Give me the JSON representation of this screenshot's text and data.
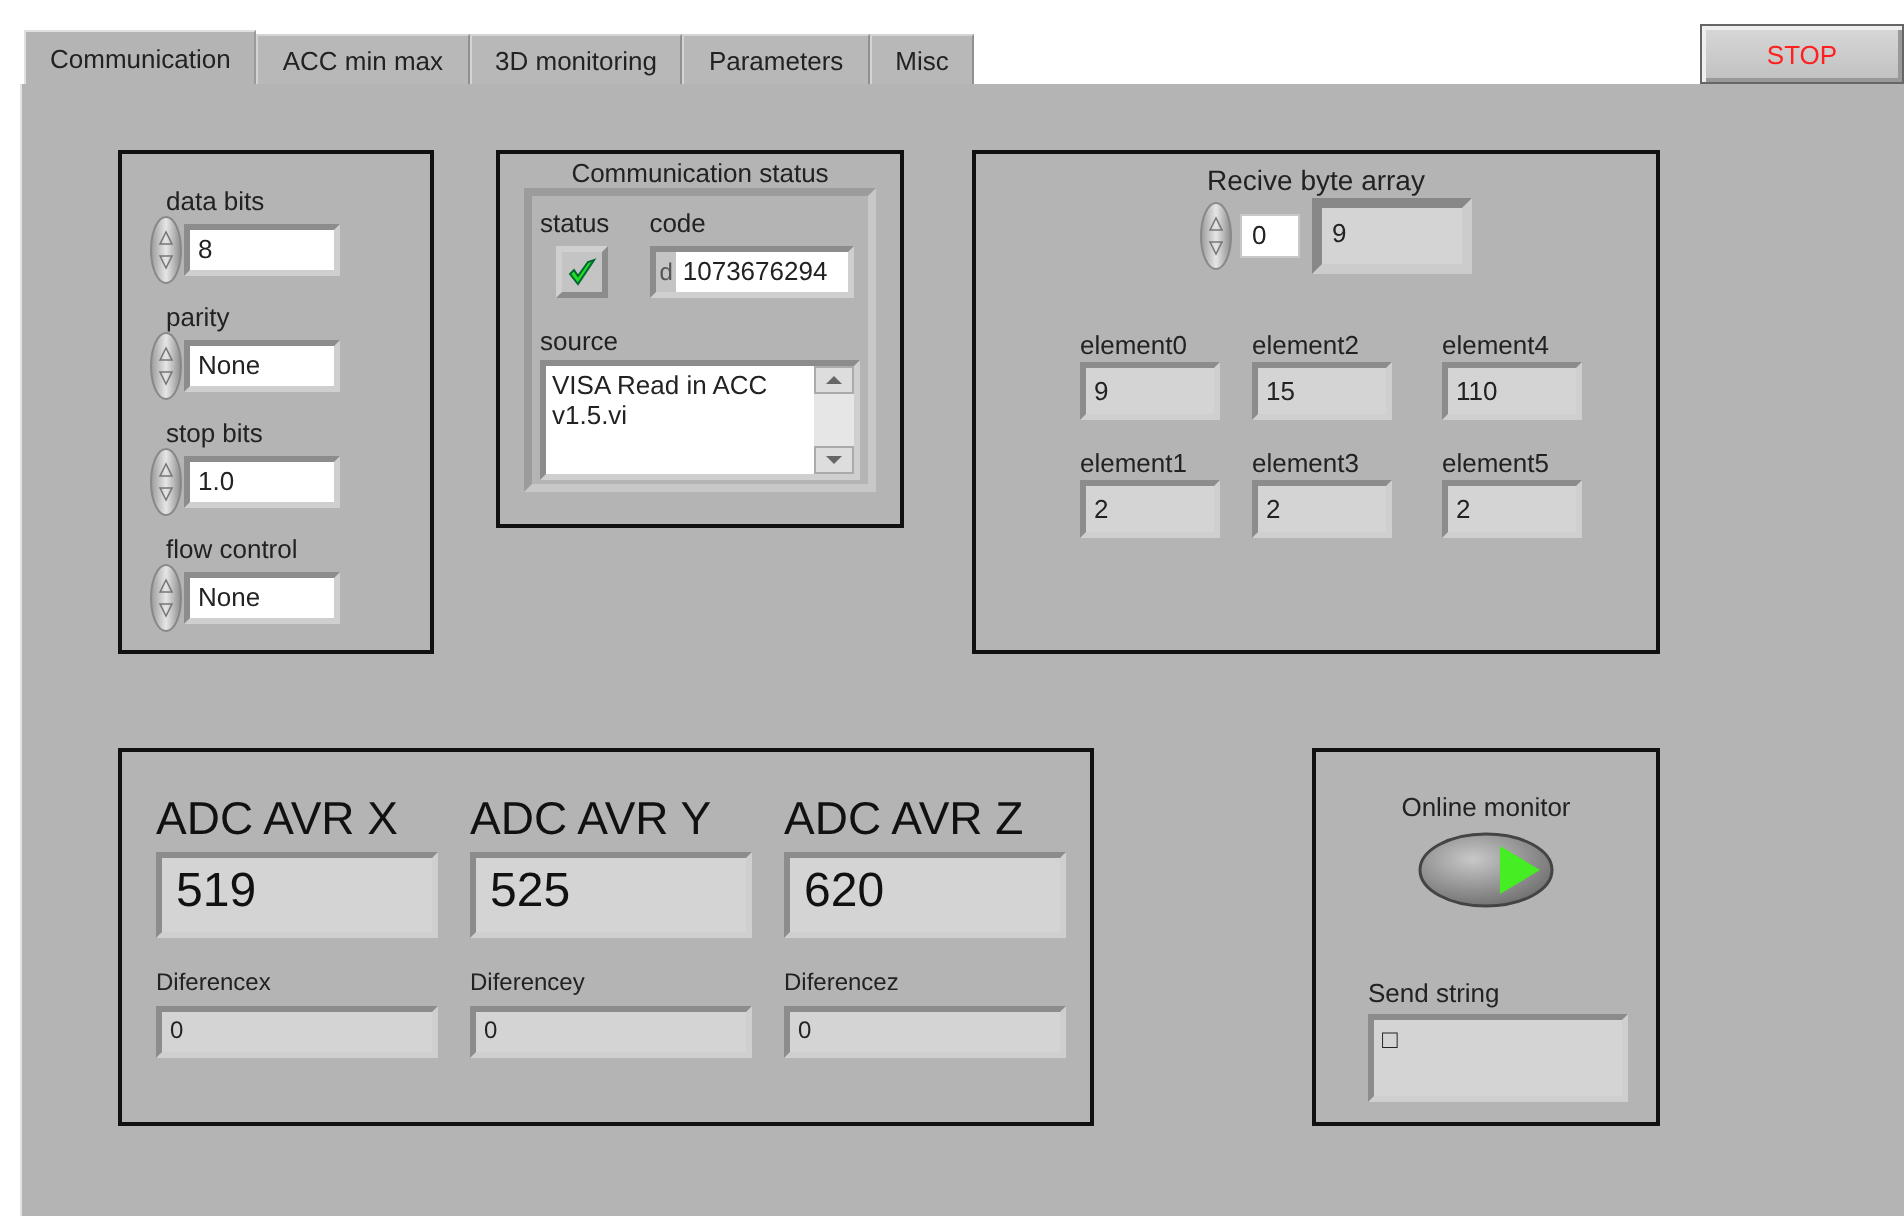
{
  "tabs": [
    {
      "label": "Communication",
      "selected": true
    },
    {
      "label": "ACC min max",
      "selected": false
    },
    {
      "label": "3D monitoring",
      "selected": false
    },
    {
      "label": "Parameters",
      "selected": false
    },
    {
      "label": "Misc",
      "selected": false
    }
  ],
  "stop_button": {
    "label": "STOP"
  },
  "serial_settings": [
    {
      "label": "data bits",
      "value": "8"
    },
    {
      "label": "parity",
      "value": "None"
    },
    {
      "label": "stop bits",
      "value": "1.0"
    },
    {
      "label": "flow control",
      "value": "None"
    }
  ],
  "communication_status": {
    "title": "Communication status",
    "status_label": "status",
    "status_checked": true,
    "code_label": "code",
    "radix": "d",
    "code": "1073676294",
    "source_label": "source",
    "source": "VISA Read in ACC v1.5.vi"
  },
  "receive_byte_array": {
    "title": "Recive byte array",
    "index": "0",
    "value": "9",
    "elements": [
      {
        "label": "element0",
        "value": "9"
      },
      {
        "label": "element2",
        "value": "15"
      },
      {
        "label": "element4",
        "value": "110"
      },
      {
        "label": "element1",
        "value": "2"
      },
      {
        "label": "element3",
        "value": "2"
      },
      {
        "label": "element5",
        "value": "2"
      }
    ]
  },
  "adc": [
    {
      "label": "ADC AVR X",
      "value": "519",
      "diff_label": "Diferencex",
      "diff_value": "0"
    },
    {
      "label": "ADC AVR Y",
      "value": "525",
      "diff_label": "Diferencey",
      "diff_value": "0"
    },
    {
      "label": "ADC AVR Z",
      "value": "620",
      "diff_label": "Diferencez",
      "diff_value": "0"
    }
  ],
  "online_monitor": {
    "label": "Online monitor",
    "on": true
  },
  "send_string": {
    "label": "Send string",
    "value": "□"
  }
}
